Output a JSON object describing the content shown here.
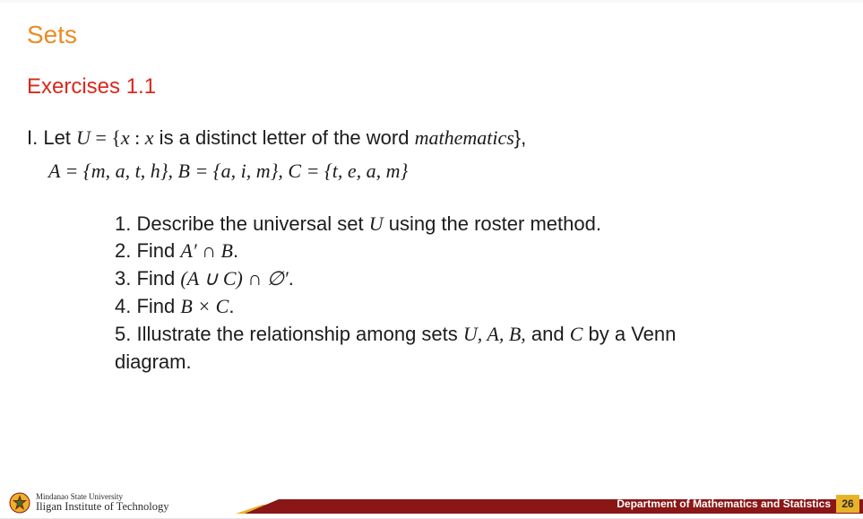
{
  "title": "Sets",
  "subtitle": "Exercises 1.1",
  "lead_prefix": "I. Let ",
  "lead_U": "U",
  "lead_eq": " = {",
  "lead_x": "x",
  "lead_colon": " : ",
  "lead_x2": "x",
  "lead_rest": " is a distinct letter of the word ",
  "lead_word": "mathematics",
  "lead_close": "},",
  "sets_line_A": "A",
  "sets_line_Aval": " = {m, a, t, h},  ",
  "sets_line_B": "B",
  "sets_line_Bval": " = {a, i, m},  ",
  "sets_line_C": "C",
  "sets_line_Cval": " = {t, e, a, m}",
  "items": {
    "q1a": "1. Describe the universal set ",
    "q1b": "U",
    "q1c": " using the roster method.",
    "q2a": "2. Find ",
    "q2b": "A′ ∩ B",
    "q2c": ".",
    "q3a": "3. Find ",
    "q3b": "(A ∪ C) ∩ ∅′",
    "q3c": ".",
    "q4a": "4. Find ",
    "q4b": "B × C",
    "q4c": ".",
    "q5a": "5. Illustrate the relationship among sets ",
    "q5b": "U, A, B,",
    "q5c": " and ",
    "q5d": "C",
    "q5e": " by a Venn",
    "q5f": "diagram."
  },
  "footer": {
    "uni_top": "Mindanao State University",
    "uni_bot": "Iligan Institute of Technology",
    "dept": "Department of Mathematics and Statistics",
    "page": "26"
  }
}
